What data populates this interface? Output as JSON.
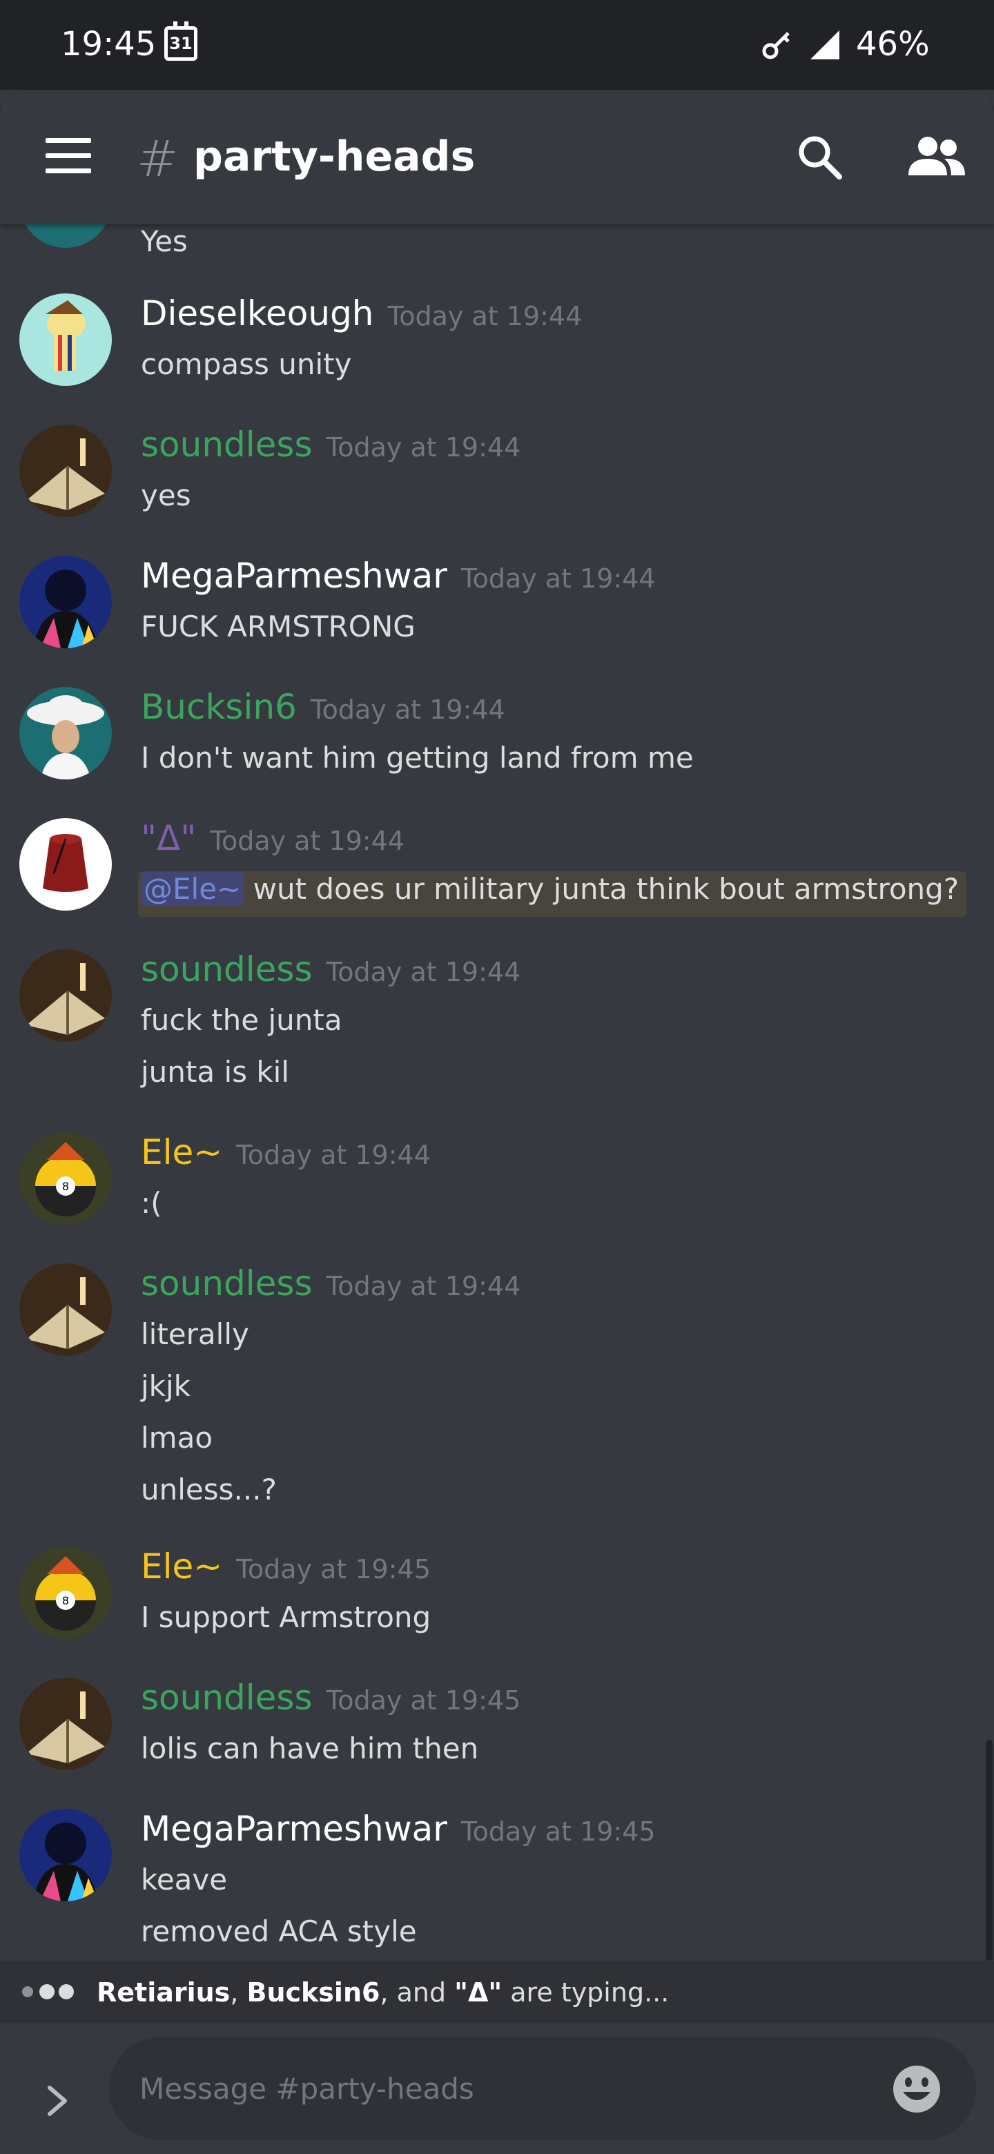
{
  "status_bar": {
    "time": "19:45",
    "calendar_day": "31",
    "battery": "46%"
  },
  "header": {
    "channel_name": "party-heads"
  },
  "colors": {
    "white": "#ffffff",
    "green": "#3ba55d",
    "purple": "#7e5fae",
    "yellow": "#f5c518"
  },
  "messages": [
    {
      "user": "",
      "time": "",
      "lines": [
        "Yes"
      ]
    },
    {
      "user": "Dieselkeough",
      "time": "Today at 19:44",
      "lines": [
        "compass unity"
      ]
    },
    {
      "user": "soundless",
      "time": "Today at 19:44",
      "lines": [
        "yes"
      ]
    },
    {
      "user": "MegaParmeshwar",
      "time": "Today at 19:44",
      "lines": [
        "FUCK ARMSTRONG"
      ]
    },
    {
      "user": "Bucksin6",
      "time": "Today at 19:44",
      "lines": [
        "I don't want him getting land from me"
      ]
    },
    {
      "user": "\"Δ\"",
      "time": "Today at 19:44",
      "mention": "@Ele~",
      "lines": [
        "wut does ur military junta think bout armstrong?"
      ]
    },
    {
      "user": "soundless",
      "time": "Today at 19:44",
      "lines": [
        "fuck the junta",
        "junta is kil"
      ]
    },
    {
      "user": "Ele~",
      "time": "Today at 19:44",
      "lines": [
        ":("
      ]
    },
    {
      "user": "soundless",
      "time": "Today at 19:44",
      "lines": [
        "literally",
        "jkjk",
        "lmao",
        "unless...?"
      ]
    },
    {
      "user": "Ele~",
      "time": "Today at 19:45",
      "lines": [
        "I support Armstrong"
      ]
    },
    {
      "user": "soundless",
      "time": "Today at 19:45",
      "lines": [
        "lolis can have him then"
      ]
    },
    {
      "user": "MegaParmeshwar",
      "time": "Today at 19:45",
      "lines": [
        "keave",
        "removed ACA style"
      ]
    }
  ],
  "typing": {
    "users": [
      "Retiarius",
      "Bucksin6",
      "\"Δ\""
    ],
    "sep1": ", ",
    "sep2": ", and ",
    "suffix": " are typing..."
  },
  "input": {
    "placeholder": "Message #party-heads"
  }
}
